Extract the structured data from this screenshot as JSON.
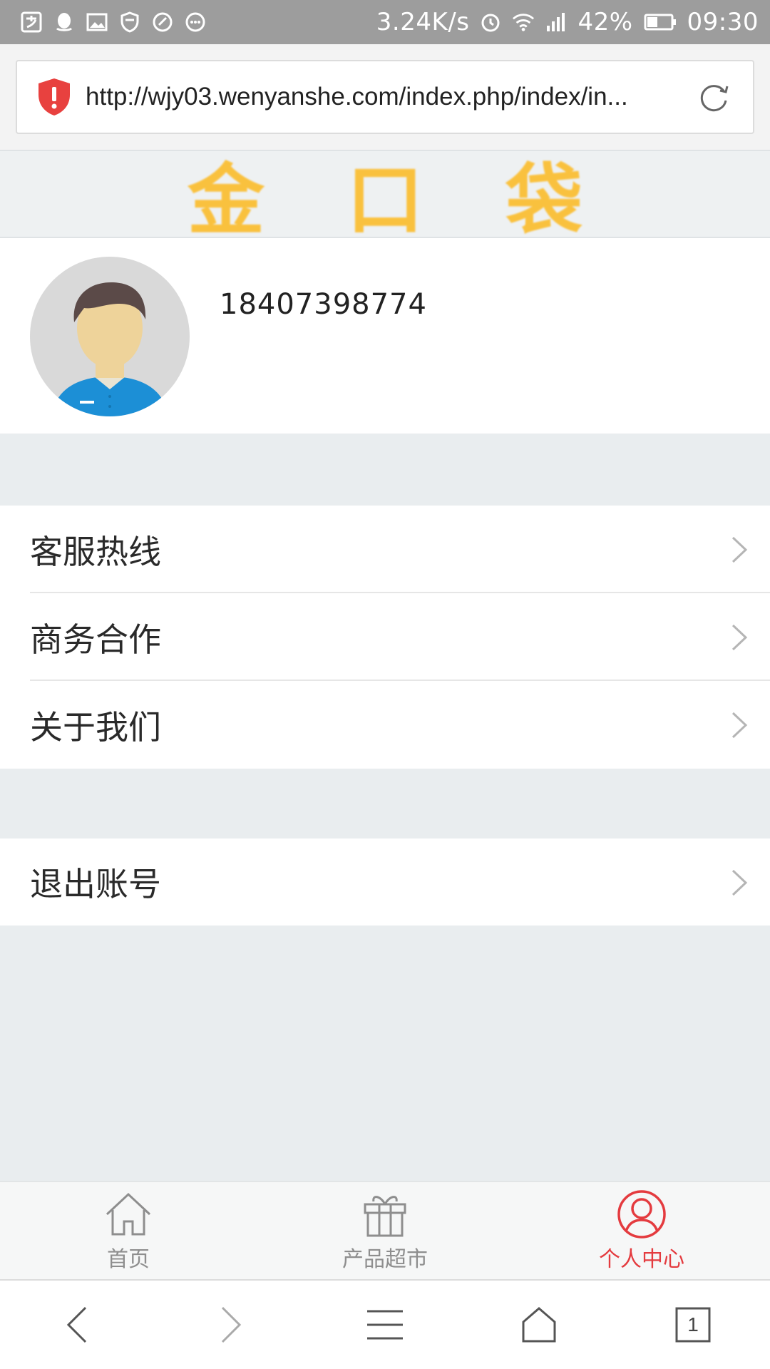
{
  "status_bar": {
    "net_speed": "3.24K/s",
    "battery": "42%",
    "time": "09:30",
    "icons": [
      "alipay-icon",
      "qq-icon",
      "gallery-icon",
      "shield-icon",
      "check-icon",
      "chat-icon",
      "alarm-icon",
      "wifi-icon",
      "signal-icon",
      "battery-icon"
    ]
  },
  "browser": {
    "url": "http://wjy03.wenyanshe.com/index.php/index/in...",
    "security_icon": "warning-shield-icon",
    "reload_icon": "reload-icon"
  },
  "logo": {
    "chars": [
      "金",
      "口",
      "袋"
    ],
    "color": "#fbbd2f"
  },
  "profile": {
    "phone": "18407398774",
    "avatar_icon": "user-avatar"
  },
  "menu_main": [
    {
      "label": "客服热线"
    },
    {
      "label": "商务合作"
    },
    {
      "label": "关于我们"
    }
  ],
  "menu_account": [
    {
      "label": "退出账号"
    }
  ],
  "app_nav": [
    {
      "label": "首页",
      "icon": "home-icon",
      "active": false
    },
    {
      "label": "产品超市",
      "icon": "gift-icon",
      "active": false
    },
    {
      "label": "个人中心",
      "icon": "user-icon",
      "active": true
    }
  ],
  "browser_toolbar": {
    "tab_count": "1",
    "buttons": [
      "back-icon",
      "forward-icon",
      "menu-icon",
      "home-icon",
      "tabs-icon"
    ]
  },
  "colors": {
    "accent": "#e43b3f",
    "logo": "#fbbd2f",
    "background": "#e9edef"
  }
}
